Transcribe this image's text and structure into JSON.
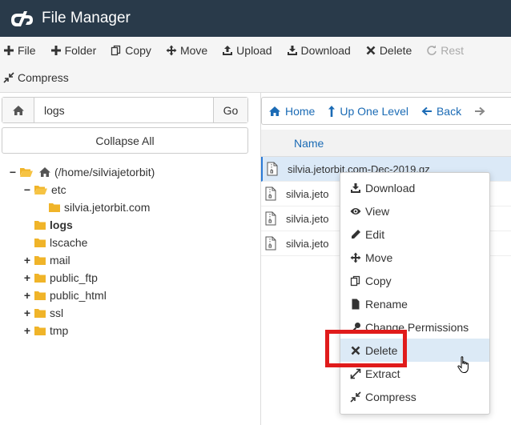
{
  "app": {
    "title": "File Manager"
  },
  "toolbar": {
    "row1": [
      {
        "label": "File",
        "icon": "plus-icon"
      },
      {
        "label": "Folder",
        "icon": "plus-icon"
      },
      {
        "label": "Copy",
        "icon": "copy-icon"
      },
      {
        "label": "Move",
        "icon": "move-icon"
      },
      {
        "label": "Upload",
        "icon": "upload-icon"
      },
      {
        "label": "Download",
        "icon": "download-icon"
      },
      {
        "label": "Delete",
        "icon": "x-icon"
      },
      {
        "label": "Rest",
        "icon": "restore-icon",
        "disabled": true
      }
    ],
    "row2": [
      {
        "label": "Compress",
        "icon": "compress-icon"
      }
    ]
  },
  "search": {
    "value": "logs",
    "go_label": "Go"
  },
  "sidebar": {
    "collapse_label": "Collapse All",
    "tree": [
      {
        "label": "(/home/silviajetorbit)",
        "toggle": "−",
        "icon": "home-folder",
        "indent": 0
      },
      {
        "label": "etc",
        "toggle": "−",
        "icon": "folder-open",
        "indent": 1
      },
      {
        "label": "silvia.jetorbit.com",
        "toggle": "",
        "icon": "folder",
        "indent": 2
      },
      {
        "label": "logs",
        "toggle": "",
        "icon": "folder",
        "indent": 1,
        "bold": true
      },
      {
        "label": "lscache",
        "toggle": "",
        "icon": "folder",
        "indent": 1
      },
      {
        "label": "mail",
        "toggle": "+",
        "icon": "folder",
        "indent": 1
      },
      {
        "label": "public_ftp",
        "toggle": "+",
        "icon": "folder",
        "indent": 1
      },
      {
        "label": "public_html",
        "toggle": "+",
        "icon": "folder",
        "indent": 1
      },
      {
        "label": "ssl",
        "toggle": "+",
        "icon": "folder",
        "indent": 1
      },
      {
        "label": "tmp",
        "toggle": "+",
        "icon": "folder",
        "indent": 1
      }
    ]
  },
  "nav": {
    "home": "Home",
    "up": "Up One Level",
    "back": "Back"
  },
  "files": {
    "header_name": "Name",
    "rows": [
      {
        "name": "silvia.jetorbit.com-Dec-2019.gz",
        "selected": true
      },
      {
        "name": "silvia.jeto",
        "selected": false
      },
      {
        "name": "silvia.jeto",
        "selected": false
      },
      {
        "name": "silvia.jeto",
        "selected": false
      }
    ]
  },
  "context_menu": {
    "items": [
      {
        "label": "Download",
        "icon": "download-icon"
      },
      {
        "label": "View",
        "icon": "eye-icon"
      },
      {
        "label": "Edit",
        "icon": "pencil-icon"
      },
      {
        "label": "Move",
        "icon": "move-icon"
      },
      {
        "label": "Copy",
        "icon": "copy-icon"
      },
      {
        "label": "Rename",
        "icon": "file-icon"
      },
      {
        "label": "Change Permissions",
        "icon": "key-icon"
      },
      {
        "label": "Delete",
        "icon": "x-icon",
        "hover": true
      },
      {
        "label": "Extract",
        "icon": "expand-icon"
      },
      {
        "label": "Compress",
        "icon": "compress-icon"
      }
    ]
  },
  "colors": {
    "header_bg": "#293a4a",
    "link": "#1b6bb5",
    "folder": "#f0b429",
    "highlight": "#e01b1b"
  }
}
